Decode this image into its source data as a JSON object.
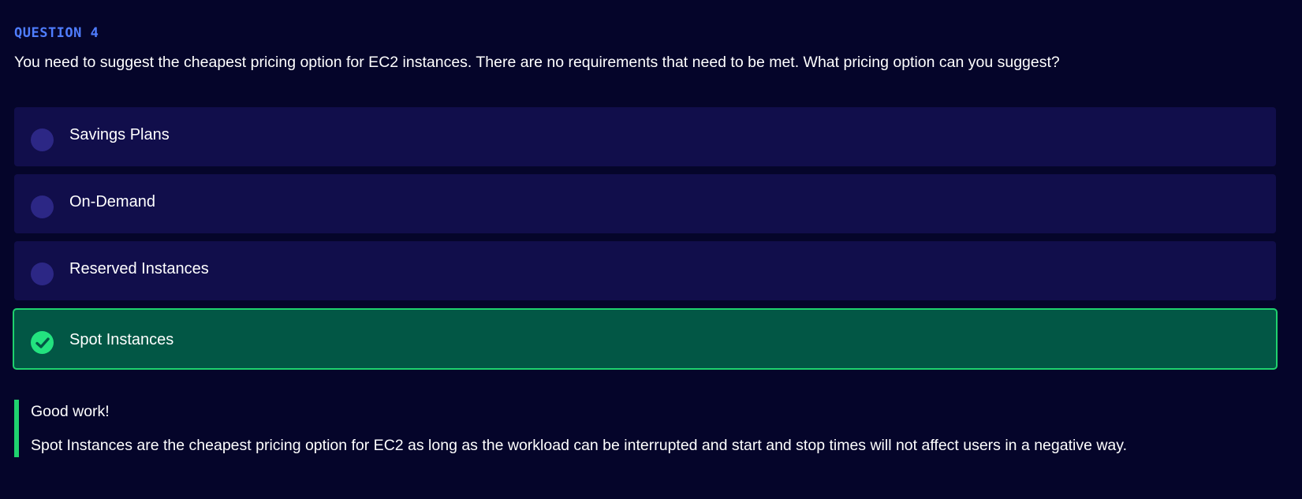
{
  "question": {
    "label": "QUESTION 4",
    "text": "You need to suggest the cheapest pricing option for EC2 instances. There are no requirements that need to be met. What pricing option can you suggest?"
  },
  "options": [
    {
      "label": "Savings Plans",
      "state": "unselected"
    },
    {
      "label": "On-Demand",
      "state": "unselected"
    },
    {
      "label": "Reserved Instances",
      "state": "unselected"
    },
    {
      "label": "Spot Instances",
      "state": "correct"
    }
  ],
  "feedback": {
    "title": "Good work!",
    "text": "Spot Instances are the cheapest pricing option for EC2 as long as the workload can be interrupted and start and stop times will not affect users in a negative way."
  },
  "colors": {
    "background": "#05052a",
    "accent_label": "#4f7dff",
    "option_bg": "#110e4b",
    "radio_bg": "#2c2785",
    "correct_bg": "#025745",
    "correct_border": "#1fd26e",
    "check_icon_bg": "#23e27f"
  },
  "icons": {
    "correct": "check-circle-icon",
    "unselected": "radio-circle-icon"
  }
}
